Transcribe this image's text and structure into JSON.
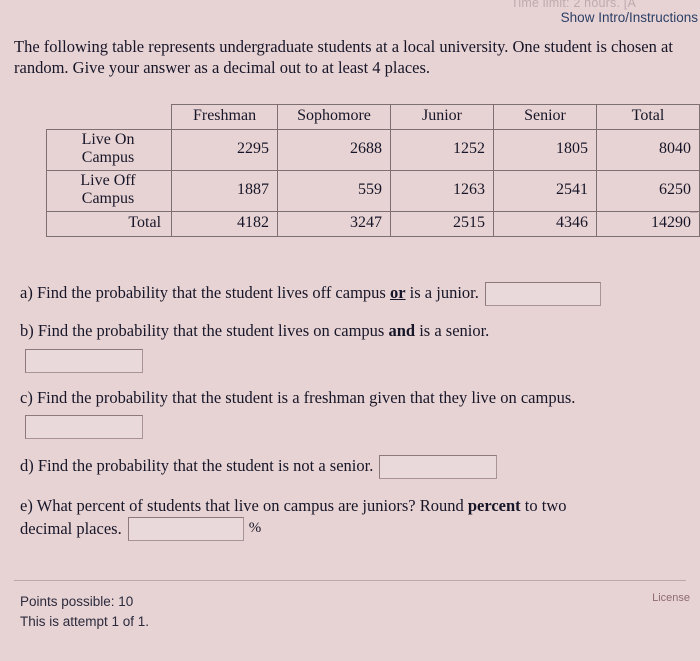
{
  "header": {
    "timelimit_ghost": "Time limit: 2 hours. [A",
    "show_intro": "Show Intro/Instructions"
  },
  "prompt": {
    "line1": "The following table represents undergraduate students at a local university. One",
    "line2": "student is chosen at random. Give your answer as a decimal out to at least 4 places."
  },
  "table": {
    "columns": [
      "",
      "Freshman",
      "Sophomore",
      "Junior",
      "Senior",
      "Total"
    ],
    "rows": [
      {
        "label": "Live On Campus",
        "values": [
          "2295",
          "2688",
          "1252",
          "1805",
          "8040"
        ]
      },
      {
        "label": "Live Off Campus",
        "values": [
          "1887",
          "559",
          "1263",
          "2541",
          "6250"
        ]
      },
      {
        "label": "Total",
        "values": [
          "4182",
          "3247",
          "2515",
          "4346",
          "14290"
        ]
      }
    ]
  },
  "parts": {
    "a": {
      "pre": "a) Find the probability that the student lives off campus ",
      "em": "or",
      "post": " is a junior.",
      "answer": ""
    },
    "b": {
      "pre": "b) Find the probability that the student lives on campus ",
      "em": "and",
      "post": " is a senior.",
      "answer": ""
    },
    "c": {
      "text": "c) Find the probability that the student is a freshman given that they live on campus.",
      "answer": ""
    },
    "d": {
      "text": "d) Find the probability that the student is not a senior.",
      "answer": ""
    },
    "e": {
      "pre": "e) What percent of students that live on campus are juniors? Round ",
      "em": "percent",
      "post": " to two",
      "line2": "decimal places.",
      "answer": "",
      "unit": "%"
    }
  },
  "footer": {
    "points": "Points possible: 10",
    "attempt": "This is attempt 1 of 1.",
    "license": "License"
  }
}
